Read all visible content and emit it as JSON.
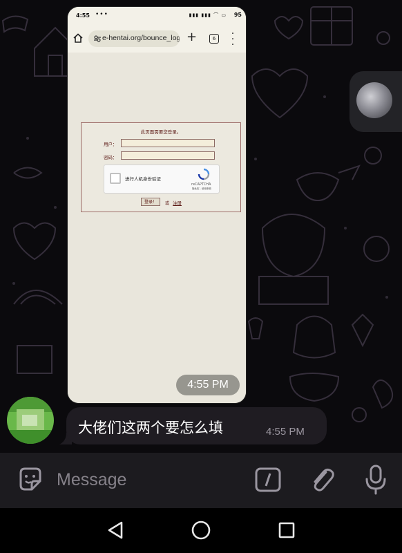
{
  "conversation": {
    "image_message": {
      "time": "4:55 PM",
      "screenshot": {
        "status_bar": {
          "time": "4:55",
          "dots": "•••",
          "battery": "95"
        },
        "browser": {
          "url": "e-hentai.org/bounce_log",
          "tab_count": "6",
          "home_icon": "home-icon",
          "more_icon": "vertical-dots-icon"
        },
        "login_form": {
          "heading": "此页面需要您登录。",
          "username_label": "用户：",
          "password_label": "密码：",
          "captcha": {
            "label": "进行人机身份验证",
            "brand": "reCAPTCHA",
            "links": "隐私权 - 使用条款"
          },
          "login_button": "登录！",
          "or_text": "或",
          "register_link": "注册"
        }
      }
    },
    "text_message": {
      "text": "大佬们这两个要怎么填",
      "time": "4:55 PM"
    }
  },
  "composer": {
    "placeholder": "Message",
    "sticker_icon": "sticker-icon",
    "command_icon": "slash-command-icon",
    "attach_icon": "paperclip-icon",
    "mic_icon": "microphone-icon"
  },
  "navigation": {
    "back_icon": "triangle-back-icon",
    "home_icon": "circle-home-icon",
    "recents_icon": "square-recents-icon"
  },
  "colors": {
    "background": "#0b0a0d",
    "bubble": "#1f1c22",
    "composer": "#1c1b1f",
    "login_border": "#9c6b66",
    "login_text": "#5c1a16"
  }
}
